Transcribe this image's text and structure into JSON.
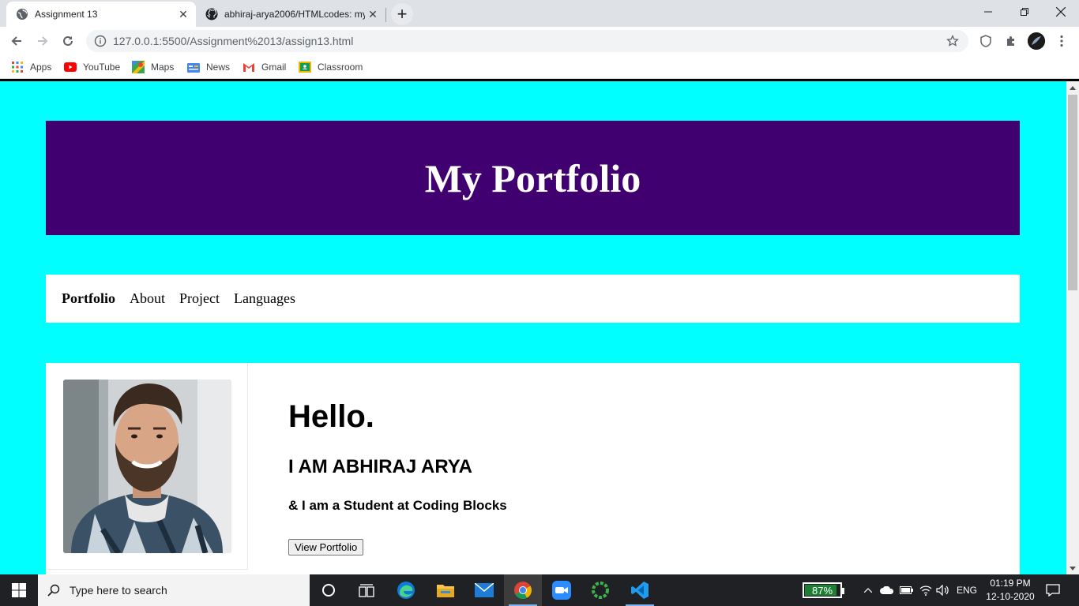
{
  "browser": {
    "tabs": [
      {
        "title": "Assignment 13",
        "active": true
      },
      {
        "title": "abhiraj-arya2006/HTMLcodes: my",
        "active": false
      }
    ],
    "url": "127.0.0.1:5500/Assignment%2013/assign13.html",
    "bookmarks": [
      "Apps",
      "YouTube",
      "Maps",
      "News",
      "Gmail",
      "Classroom"
    ]
  },
  "page": {
    "title": "My Portfolio",
    "nav": [
      "Portfolio",
      "About",
      "Project",
      "Languages"
    ],
    "hello": "Hello.",
    "name": "I AM ABHIRAJ ARYA",
    "tagline": "& I am a Student at Coding Blocks",
    "button": "View Portfolio",
    "colors": {
      "background": "#00ffff",
      "header": "#400070"
    }
  },
  "taskbar": {
    "search_placeholder": "Type here to search",
    "battery": "87%",
    "language": "ENG",
    "time": "01:19 PM",
    "date": "12-10-2020"
  }
}
